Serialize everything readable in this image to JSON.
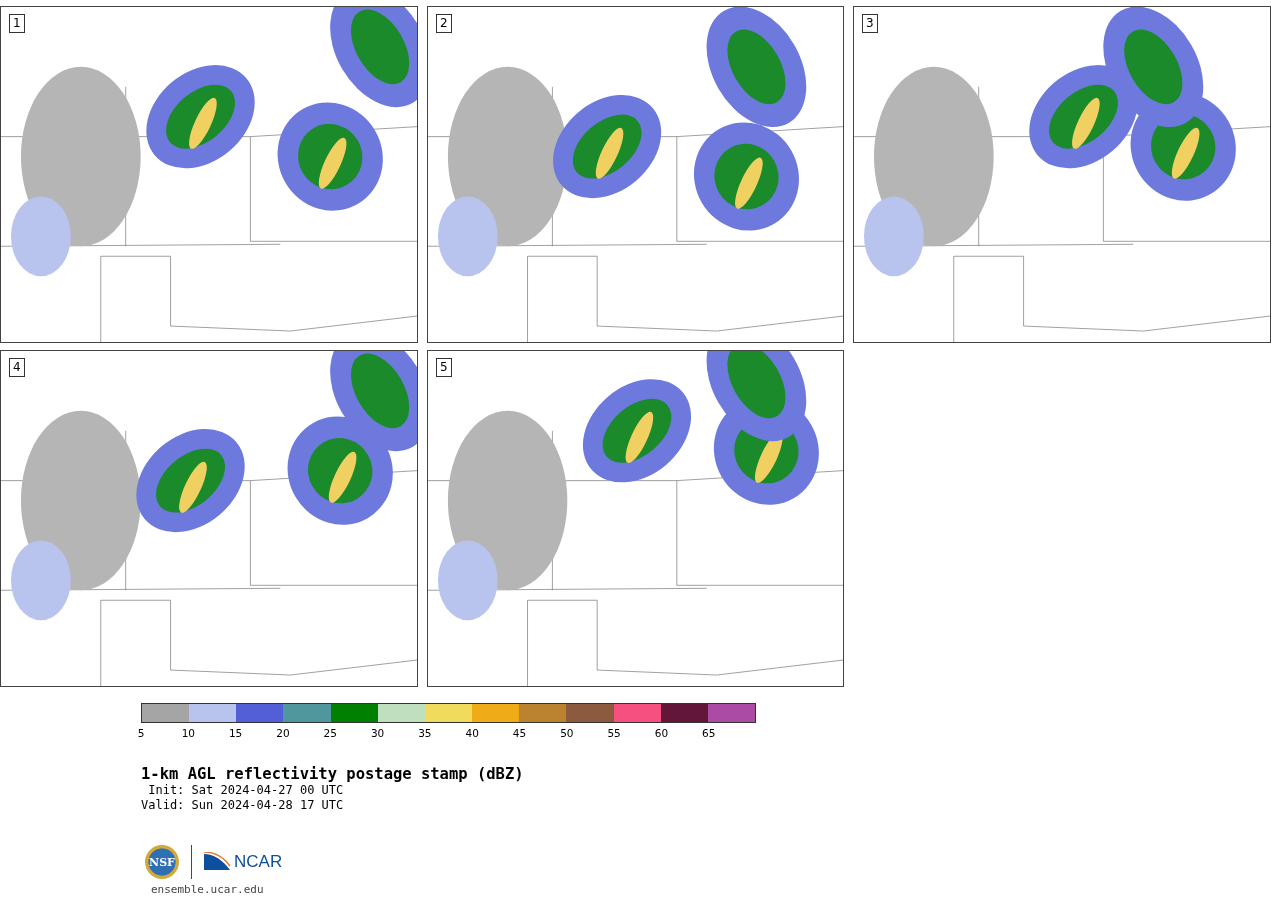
{
  "panels": [
    {
      "label": "1"
    },
    {
      "label": "2"
    },
    {
      "label": "3"
    },
    {
      "label": "4"
    },
    {
      "label": "5"
    }
  ],
  "colorbar": {
    "segments": [
      {
        "color": "#a5a5a5"
      },
      {
        "color": "#b8c3ee"
      },
      {
        "color": "#525fd6"
      },
      {
        "color": "#4f979c"
      },
      {
        "color": "#008000"
      },
      {
        "color": "#bfdfbf"
      },
      {
        "color": "#f0db5a"
      },
      {
        "color": "#f0ac16"
      },
      {
        "color": "#bb8330"
      },
      {
        "color": "#8b5a3f"
      },
      {
        "color": "#f65080"
      },
      {
        "color": "#621638"
      },
      {
        "color": "#ab4ba5"
      }
    ],
    "ticks": [
      "5",
      "10",
      "15",
      "20",
      "25",
      "30",
      "35",
      "40",
      "45",
      "50",
      "55",
      "60",
      "65"
    ]
  },
  "title": "1-km AGL reflectivity postage stamp (dBZ)",
  "init": "Init: Sat 2024-04-27 00 UTC",
  "valid": "Valid: Sun 2024-04-28 17 UTC",
  "logo": {
    "left": "NSF",
    "right": "NCAR"
  },
  "site": "ensemble.ucar.edu"
}
